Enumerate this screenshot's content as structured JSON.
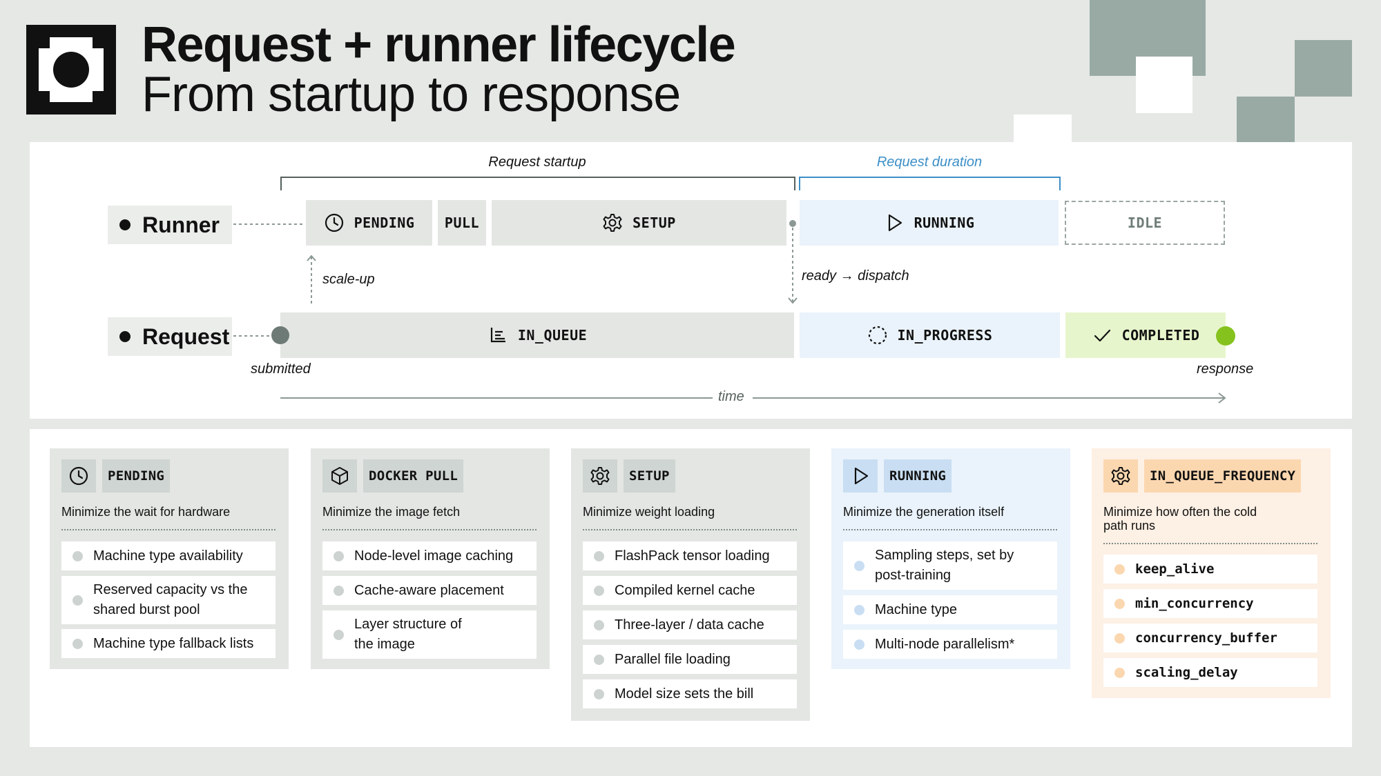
{
  "header": {
    "title": "Request + runner lifecycle",
    "subtitle": "From startup to response"
  },
  "timeline": {
    "bracket_startup": "Request startup",
    "bracket_duration": "Request duration",
    "runner_label": "Runner",
    "request_label": "Request",
    "runner_stages": {
      "pending": "PENDING",
      "pull": "PULL",
      "setup": "SETUP",
      "running": "RUNNING",
      "idle": "IDLE"
    },
    "request_stages": {
      "in_queue": "IN_QUEUE",
      "in_progress": "IN_PROGRESS",
      "completed": "COMPLETED"
    },
    "annotations": {
      "scale_up": "scale-up",
      "ready_dispatch": "ready → dispatch",
      "submitted": "submitted",
      "response": "response",
      "time": "time"
    }
  },
  "cards": [
    {
      "title": "PENDING",
      "icon": "clock-icon",
      "subtitle": "Minimize the wait for hardware",
      "items": [
        "Machine type availability",
        "Reserved capacity vs the shared burst pool",
        "Machine type fallback lists"
      ]
    },
    {
      "title": "DOCKER PULL",
      "icon": "cube-icon",
      "subtitle": "Minimize the image fetch",
      "items": [
        "Node-level image caching",
        "Cache-aware placement",
        "Layer structure of the image"
      ]
    },
    {
      "title": "SETUP",
      "icon": "gear-icon",
      "subtitle": "Minimize weight loading",
      "items": [
        "FlashPack tensor loading",
        "Compiled kernel cache",
        "Three-layer / data cache",
        "Parallel file loading",
        "Model size sets the bill"
      ]
    },
    {
      "title": "RUNNING",
      "icon": "play-icon",
      "subtitle": "Minimize the generation itself",
      "items": [
        "Sampling steps, set by post-training",
        "Machine type",
        "Multi-node parallelism*"
      ]
    },
    {
      "title": "IN_QUEUE_FREQUENCY",
      "icon": "gear-icon",
      "subtitle": "Minimize how often the cold path runs",
      "items": [
        "keep_alive",
        "min_concurrency",
        "concurrency_buffer",
        "scaling_delay"
      ]
    }
  ],
  "colors": {
    "background": "#e5e8e5",
    "accent_blue": "#3b8fc7",
    "completed_green": "#86c21d",
    "decor": "#99aaa5"
  }
}
